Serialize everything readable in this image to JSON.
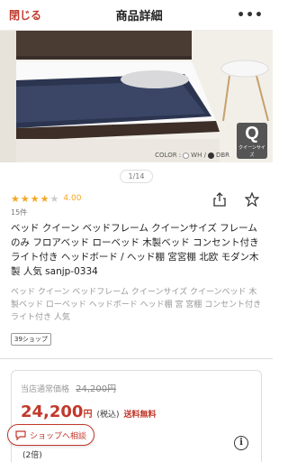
{
  "header": {
    "close_label": "閉じる",
    "title": "商品詳細",
    "more_label": "•••"
  },
  "hero": {
    "color_label": "COLOR :",
    "color_wh": "WH /",
    "color_dbr": "DBR",
    "size_badge_letter": "Q",
    "size_badge_sub": "クイーンサイズ"
  },
  "pager": "1/14",
  "rating": {
    "stars_filled": 4,
    "stars_total": 5,
    "value": "4.00",
    "review_count": "15件"
  },
  "product": {
    "name": "ベッド クイーン ベッドフレーム クイーンサイズ フレームのみ フロアベッド ローベッド 木製ベッド コンセント付き ライト付き ヘッドボード / ヘッド棚 宮宮棚 北欧 モダン木製 人気 sanjp-0334",
    "subtitle": "ベッド クイーン ベッドフレーム クイーンサイズ クイーンベッド 木製ベッド ローベッド ヘッドボード ヘッド棚 宮 宮棚 コンセント付き ライト付き 人気"
  },
  "shop_tag": "39ショップ",
  "price": {
    "regular_label": "当店通常価格",
    "regular_value": "24,200円",
    "current_value": "24,200",
    "currency": "円",
    "tax_label": "(税込)",
    "shipping_label": "送料無料",
    "count_text": "(2倍)"
  },
  "consult_button": "ショップへ相談",
  "colors": {
    "accent": "#c0392b",
    "star": "#f5a623"
  }
}
